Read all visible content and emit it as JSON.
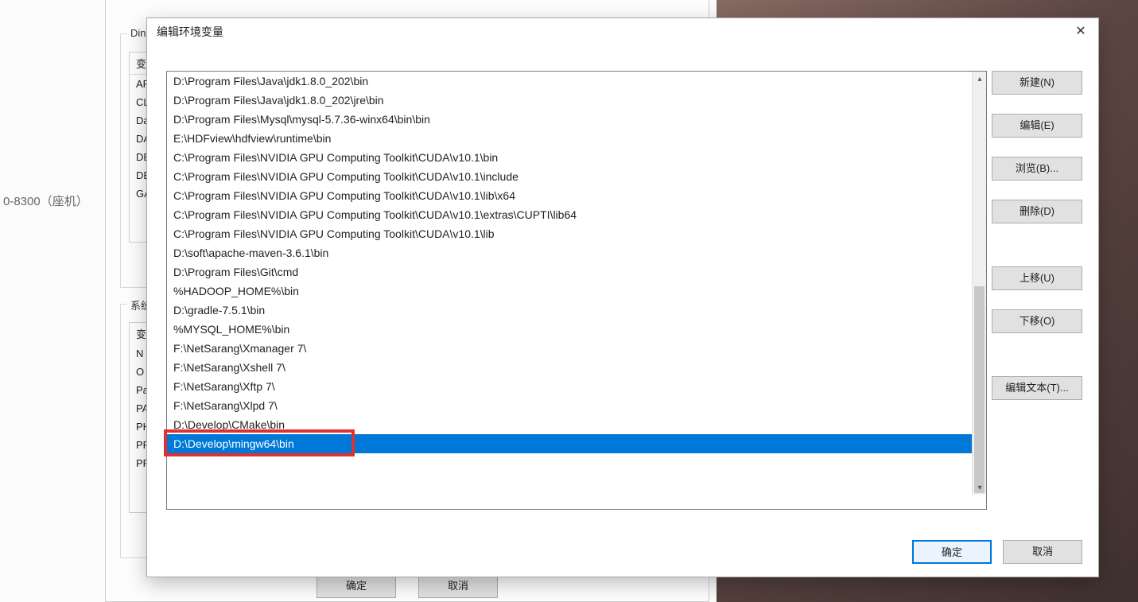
{
  "background_text": "0-8300（座机）",
  "parent": {
    "group1_title": "Ding",
    "group2_title": "系统",
    "col_var": "变",
    "upper_rows": [
      "AP",
      "CL",
      "Da",
      "DA",
      "DE",
      "DE",
      "GA"
    ],
    "lower_rows": [
      "变",
      "N",
      "O",
      "Pa",
      "PA",
      "PH",
      "PR",
      "PR"
    ],
    "ok": "确定",
    "cancel": "取消"
  },
  "modal": {
    "title": "编辑环境变量",
    "rows": [
      "D:\\Program Files\\Java\\jdk1.8.0_202\\bin",
      "D:\\Program Files\\Java\\jdk1.8.0_202\\jre\\bin",
      "D:\\Program Files\\Mysql\\mysql-5.7.36-winx64\\bin\\bin",
      "E:\\HDFview\\hdfview\\runtime\\bin",
      "C:\\Program Files\\NVIDIA GPU Computing Toolkit\\CUDA\\v10.1\\bin",
      "C:\\Program Files\\NVIDIA GPU Computing Toolkit\\CUDA\\v10.1\\include",
      "C:\\Program Files\\NVIDIA GPU Computing Toolkit\\CUDA\\v10.1\\lib\\x64",
      "C:\\Program Files\\NVIDIA GPU Computing Toolkit\\CUDA\\v10.1\\extras\\CUPTI\\lib64",
      "C:\\Program Files\\NVIDIA GPU Computing Toolkit\\CUDA\\v10.1\\lib",
      "D:\\soft\\apache-maven-3.6.1\\bin",
      "D:\\Program Files\\Git\\cmd",
      "%HADOOP_HOME%\\bin",
      "D:\\gradle-7.5.1\\bin",
      "%MYSQL_HOME%\\bin",
      "F:\\NetSarang\\Xmanager 7\\",
      "F:\\NetSarang\\Xshell 7\\",
      "F:\\NetSarang\\Xftp 7\\",
      "F:\\NetSarang\\Xlpd 7\\",
      "D:\\Develop\\CMake\\bin",
      "D:\\Develop\\mingw64\\bin"
    ],
    "selected_index": 19,
    "buttons": {
      "new": "新建(N)",
      "edit": "编辑(E)",
      "browse": "浏览(B)...",
      "delete": "删除(D)",
      "move_up": "上移(U)",
      "move_down": "下移(O)",
      "edit_text": "编辑文本(T)...",
      "ok": "确定",
      "cancel": "取消"
    }
  }
}
